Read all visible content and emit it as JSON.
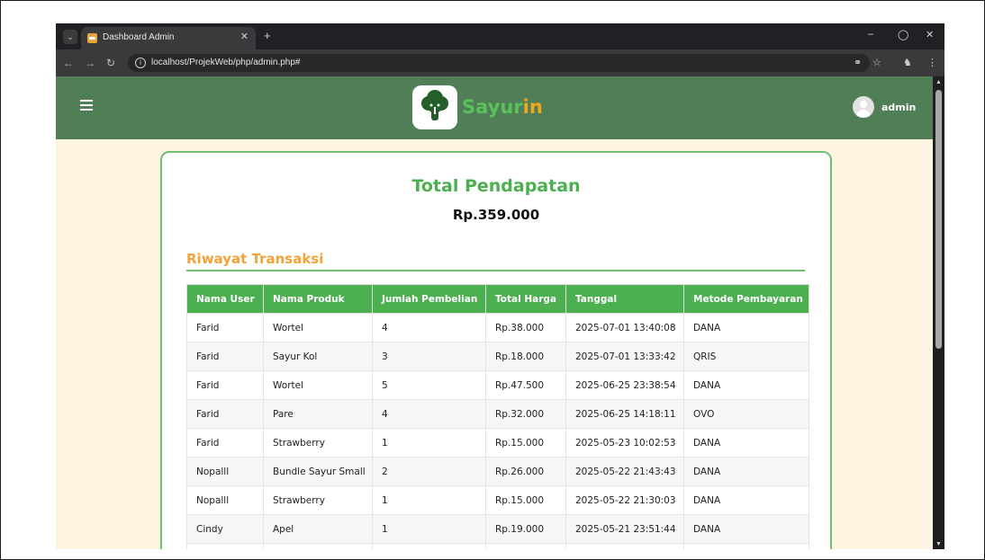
{
  "browser": {
    "tab_title": "Dashboard Admin",
    "url": "localhost/ProjekWeb/php/admin.php#"
  },
  "header": {
    "brand_part1": "Sayur",
    "brand_part2": "in",
    "username": "admin",
    "colors": {
      "header_bg": "#507e57",
      "brand_green": "#5cc15a",
      "brand_orange": "#f0a71c"
    }
  },
  "summary": {
    "title": "Total Pendapatan",
    "value": "Rp.359.000"
  },
  "history": {
    "title": "Riwayat Transaksi",
    "columns": [
      "Nama User",
      "Nama Produk",
      "Jumlah Pembelian",
      "Total Harga",
      "Tanggal",
      "Metode Pembayaran"
    ],
    "rows": [
      [
        "Farid",
        "Wortel",
        "4",
        "Rp.38.000",
        "2025-07-01 13:40:08",
        "DANA"
      ],
      [
        "Farid",
        "Sayur Kol",
        "3",
        "Rp.18.000",
        "2025-07-01 13:33:42",
        "QRIS"
      ],
      [
        "Farid",
        "Wortel",
        "5",
        "Rp.47.500",
        "2025-06-25 23:38:54",
        "DANA"
      ],
      [
        "Farid",
        "Pare",
        "4",
        "Rp.32.000",
        "2025-06-25 14:18:11",
        "OVO"
      ],
      [
        "Farid",
        "Strawberry",
        "1",
        "Rp.15.000",
        "2025-05-23 10:02:53",
        "DANA"
      ],
      [
        "Nopalll",
        "Bundle Sayur Small",
        "2",
        "Rp.26.000",
        "2025-05-22 21:43:43",
        "DANA"
      ],
      [
        "Nopalll",
        "Strawberry",
        "1",
        "Rp.15.000",
        "2025-05-22 21:30:03",
        "DANA"
      ],
      [
        "Cindy",
        "Apel",
        "1",
        "Rp.19.000",
        "2025-05-21 23:51:44",
        "DANA"
      ],
      [
        "",
        "",
        "",
        "",
        "",
        ""
      ]
    ]
  }
}
